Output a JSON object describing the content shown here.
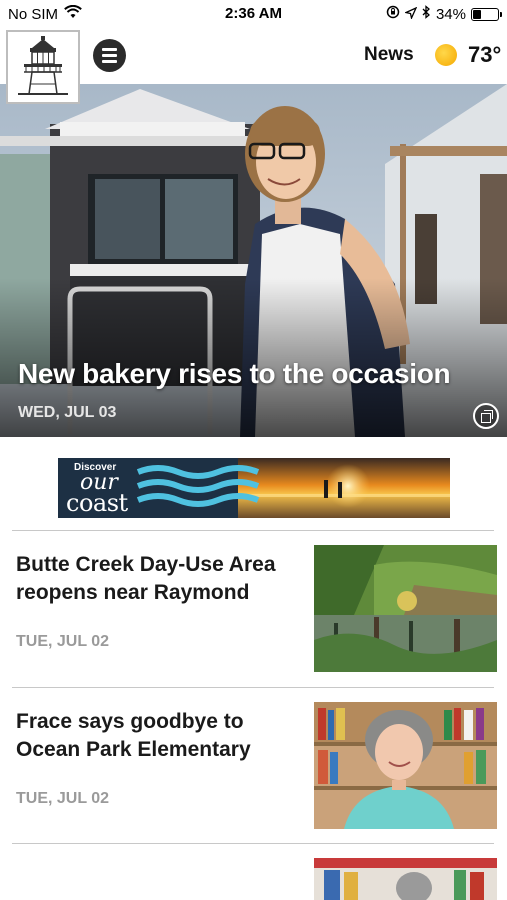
{
  "status_bar": {
    "carrier": "No SIM",
    "time": "2:36 AM",
    "battery_percent": "34%",
    "battery_level": 0.34,
    "icons": [
      "wifi-icon",
      "orientation-lock-icon",
      "location-icon",
      "bluetooth-icon",
      "battery-icon"
    ]
  },
  "header": {
    "logo_icon": "lighthouse-logo-icon",
    "menu_icon": "hamburger-menu-icon",
    "section_label": "News",
    "weather_icon": "sun-icon",
    "temperature": "73°"
  },
  "hero": {
    "title": "New bakery rises to the occasion",
    "date": "WED, JUL 03",
    "gallery_icon": "gallery-icon"
  },
  "ad": {
    "line1": "Discover",
    "line2": "our",
    "line3": "coast"
  },
  "articles": [
    {
      "title": "Butte Creek Day-Use Area reopens near Raymond",
      "date": "TUE, JUL 02"
    },
    {
      "title": "Frace says goodbye to Ocean Park Elementary",
      "date": "TUE, JUL 02"
    },
    {
      "title": "",
      "date": ""
    }
  ],
  "colors": {
    "accent_sun": "#f5a800",
    "menu_button": "#2b2b2b",
    "date_gray": "#9a9a9a",
    "divider": "#c8c8c8"
  }
}
